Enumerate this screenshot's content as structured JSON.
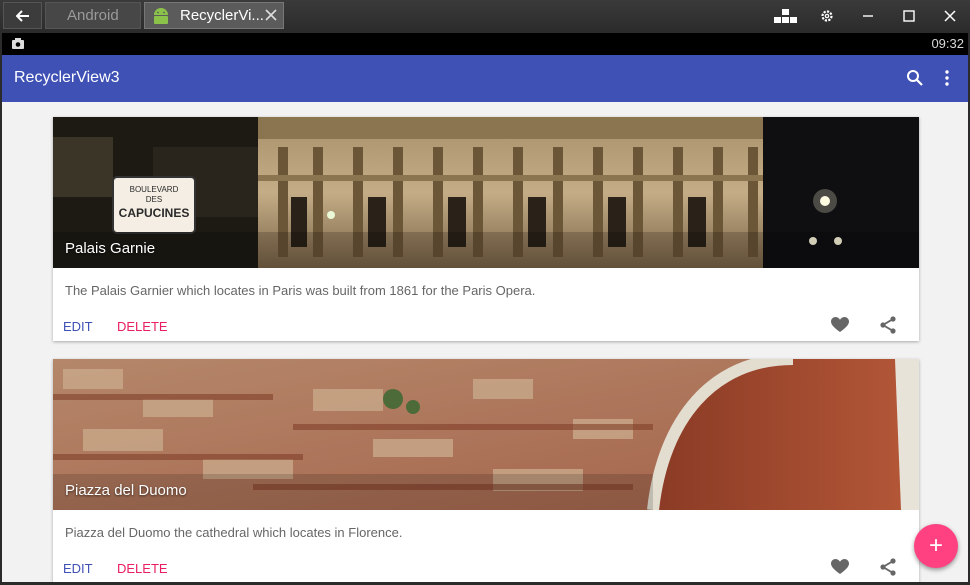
{
  "window": {
    "tabs": [
      {
        "label": "Android"
      },
      {
        "label": "RecyclerVi..."
      }
    ]
  },
  "statusbar": {
    "time": "09:32"
  },
  "appbar": {
    "title": "RecyclerView3"
  },
  "cards": [
    {
      "title": "Palais Garnie",
      "description": "The Palais Garnier which locates in Paris was built from 1861 for the Paris Opera.",
      "edit_label": "EDIT",
      "delete_label": "DELETE",
      "image_sign": [
        "BOULEVARD",
        "DES",
        "CAPUCINES"
      ]
    },
    {
      "title": "Piazza del Duomo",
      "description": "Piazza del Duomo the cathedral which locates in Florence.",
      "edit_label": "EDIT",
      "delete_label": "DELETE"
    }
  ],
  "fab": {
    "label": "+"
  },
  "colors": {
    "primary": "#3f51b5",
    "accent": "#ff4081",
    "delete": "#e91e63"
  }
}
